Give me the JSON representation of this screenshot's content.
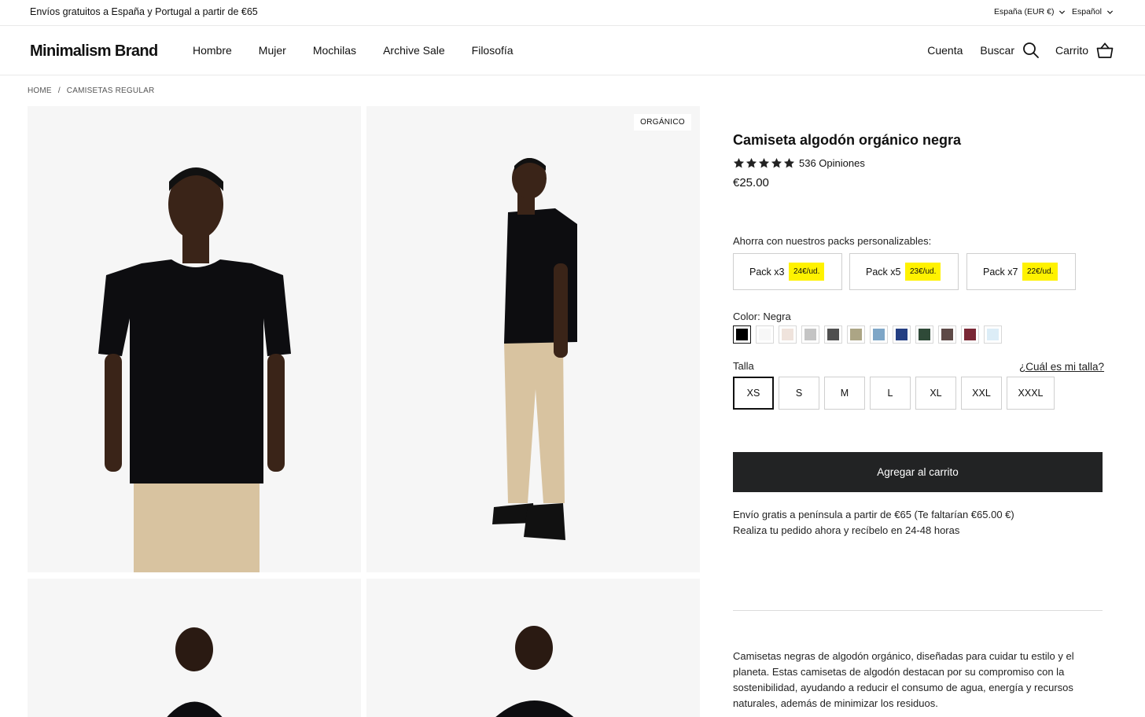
{
  "topbar": {
    "promo": "Envíos gratuitos a España y Portugal a partir de €65",
    "region": "España (EUR €)",
    "language": "Español"
  },
  "header": {
    "logo": "Minimalism Brand",
    "nav": [
      "Hombre",
      "Mujer",
      "Mochilas",
      "Archive Sale",
      "Filosofía"
    ],
    "account": "Cuenta",
    "search": "Buscar",
    "cart": "Carrito"
  },
  "breadcrumb": {
    "home": "HOME",
    "separator": "/",
    "current": "CAMISETAS REGULAR"
  },
  "gallery": {
    "badge": "ORGÁNICO"
  },
  "product": {
    "title": "Camiseta algodón orgánico negra",
    "rating": 5,
    "reviews": "536 Opiniones",
    "price": "€25.00",
    "packs_label": "Ahorra con nuestros packs personalizables:",
    "packs": [
      {
        "label": "Pack x3",
        "price": "24€/ud."
      },
      {
        "label": "Pack x5",
        "price": "23€/ud."
      },
      {
        "label": "Pack x7",
        "price": "22€/ud."
      }
    ],
    "color_prefix": "Color:",
    "color_value": "Negra",
    "colors": [
      "#000000",
      "#f7f7f7",
      "#efe3dc",
      "#c4c4c4",
      "#505050",
      "#aca585",
      "#7ea6c7",
      "#233e82",
      "#2f4a38",
      "#5e4a47",
      "#7a2735",
      "#dcedf7"
    ],
    "size_label": "Talla",
    "size_guide": "¿Cuál es mi talla?",
    "sizes": [
      "XS",
      "S",
      "M",
      "L",
      "XL",
      "XXL",
      "XXXL"
    ],
    "selected_size": "XS",
    "add_to_cart": "Agregar al carrito",
    "shipping_line1": "Envío gratis a península a partir de €65 (Te faltarían €65.00 €)",
    "shipping_line2": "Realiza tu pedido ahora y recíbelo en 24-48 horas",
    "description": "Camisetas negras de algodón orgánico, diseñadas para cuidar tu estilo y el planeta. Estas camisetas de algodón destacan por su compromiso con la sostenibilidad, ayudando a reducir el consumo de agua, energía y recursos naturales, además de minimizar los residuos."
  },
  "icons": {
    "search": "search-icon",
    "cart": "basket-icon",
    "chevron": "chevron-down-icon",
    "star": "star-icon"
  }
}
